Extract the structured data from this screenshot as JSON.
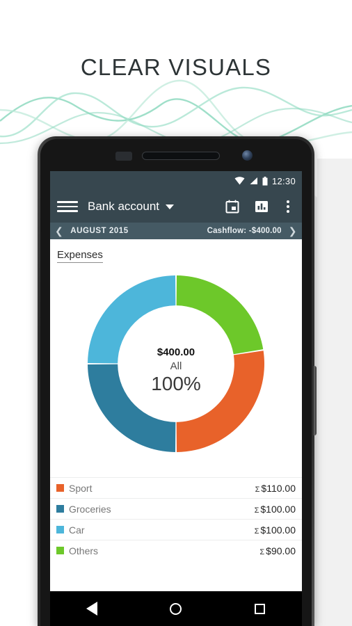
{
  "promo": {
    "headline": "CLEAR VISUALS",
    "accent_color": "#7fd3b6",
    "panel_color": "#f1f1f1"
  },
  "status_bar": {
    "time": "12:30",
    "icons": [
      "wifi-icon",
      "cellular-signal-icon",
      "battery-icon"
    ],
    "background": "#37474f"
  },
  "app_bar": {
    "menu_icon": "hamburger-menu-icon",
    "account_label": "Bank account",
    "dropdown_icon": "chevron-down-icon",
    "actions": [
      {
        "name": "calendar-icon",
        "label": "Calendar"
      },
      {
        "name": "bar-chart-icon",
        "label": "Statistics"
      },
      {
        "name": "overflow-menu-icon",
        "label": "More options"
      }
    ],
    "background": "#37474f"
  },
  "period_bar": {
    "prev_icon": "chevron-left-icon",
    "month": "AUGUST 2015",
    "cashflow": "Cashflow: -$400.00",
    "next_icon": "chevron-right-icon",
    "background": "#455a64"
  },
  "tabs": [
    {
      "label": "Expenses",
      "selected": true
    }
  ],
  "donut_center": {
    "amount": "$400.00",
    "scope": "All",
    "percent": "100%"
  },
  "legend": {
    "rows": [
      {
        "name": "Sport",
        "color": "#e8622a",
        "sigma": "Σ",
        "value": "$110.00"
      },
      {
        "name": "Groceries",
        "color": "#2e7d9e",
        "sigma": "Σ",
        "value": "$100.00"
      },
      {
        "name": "Car",
        "color": "#4db6da",
        "sigma": "Σ",
        "value": "$100.00"
      },
      {
        "name": "Others",
        "color": "#6dc82a",
        "sigma": "Σ",
        "value": "$90.00"
      }
    ]
  },
  "nav_bar": {
    "back": "back-triangle-icon",
    "home": "home-circle-icon",
    "recents": "recents-square-icon"
  },
  "chart_data": {
    "type": "pie",
    "title": "Expenses",
    "subtitle": "AUGUST 2015",
    "total": 400.0,
    "currency": "$",
    "hole_ratio": 0.66,
    "start_angle_deg": -90,
    "direction": "clockwise",
    "categories": [
      "Others",
      "Sport",
      "Groceries",
      "Car"
    ],
    "values": [
      90,
      110,
      100,
      100
    ],
    "percentages": [
      22.5,
      27.5,
      25.0,
      25.0
    ],
    "colors": [
      "#6dc82a",
      "#e8622a",
      "#2e7d9e",
      "#4db6da"
    ],
    "center_label": {
      "amount": "$400.00",
      "scope": "All",
      "percent": "100%"
    },
    "legend_position": "bottom",
    "grid": false
  }
}
